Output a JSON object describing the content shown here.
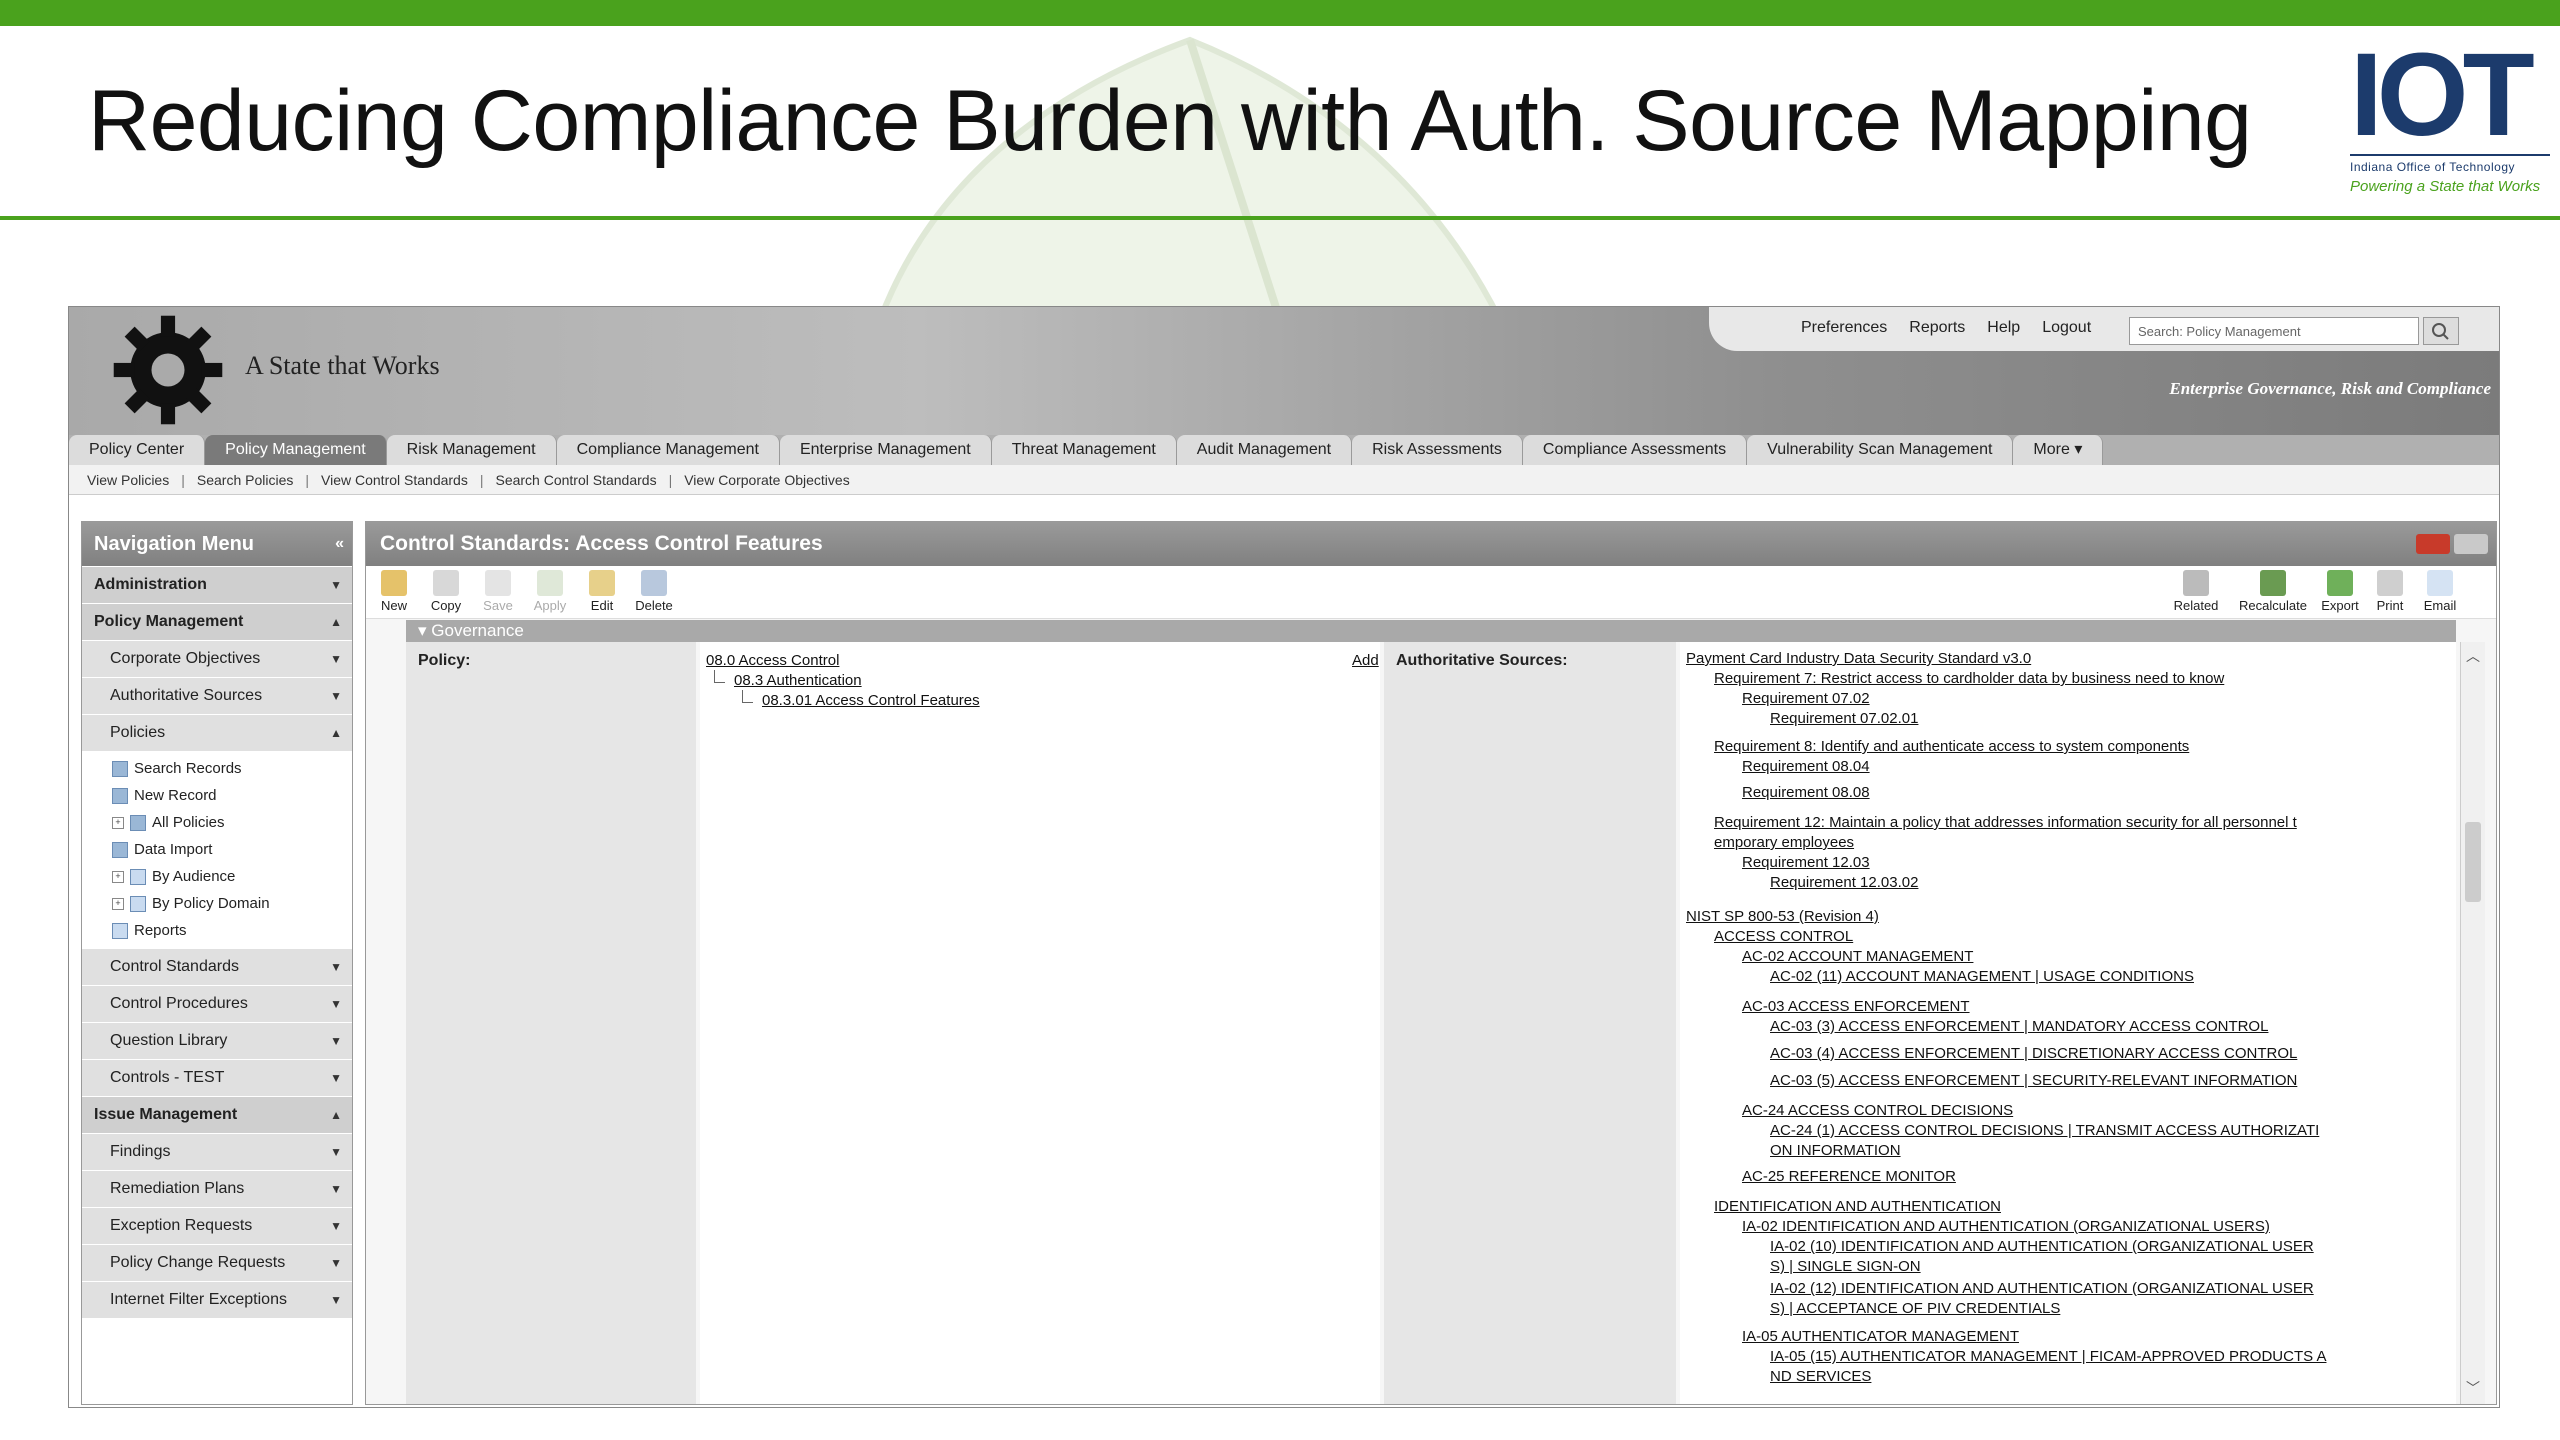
{
  "slide": {
    "title": "Reducing Compliance Burden with Auth. Source Mapping",
    "logo_main": "IOT",
    "logo_sub": "Indiana Office of Technology",
    "logo_tag": "Powering a State that Works"
  },
  "colors": {
    "brand_green": "#4aa21d",
    "brand_navy": "#1c3b6c",
    "close_red": "#c83a2a"
  },
  "banner": {
    "brand_text": "A State that Works",
    "links": [
      "Preferences",
      "Reports",
      "Help",
      "Logout"
    ],
    "search_placeholder": "Search: Policy Management",
    "tagline": "Enterprise Governance, Risk and Compliance"
  },
  "tabs": [
    "Policy Center",
    "Policy Management",
    "Risk Management",
    "Compliance Management",
    "Enterprise Management",
    "Threat Management",
    "Audit Management",
    "Risk Assessments",
    "Compliance Assessments",
    "Vulnerability Scan Management",
    "More ▾"
  ],
  "active_tab": "Policy Management",
  "subnav": [
    "View Policies",
    "Search Policies",
    "View Control Standards",
    "Search Control Standards",
    "View Corporate Objectives"
  ],
  "nav": {
    "title": "Navigation Menu",
    "administration": "Administration",
    "policy_management": "Policy Management",
    "pm_items": [
      "Corporate Objectives",
      "Authoritative Sources"
    ],
    "policies": "Policies",
    "tree": [
      "Search Records",
      "New Record",
      "All Policies",
      "Data Import",
      "By Audience",
      "By Policy Domain",
      "Reports"
    ],
    "pm_items2": [
      "Control Standards",
      "Control Procedures",
      "Question Library",
      "Controls - TEST"
    ],
    "issue_management": "Issue Management",
    "im_items": [
      "Findings",
      "Remediation Plans",
      "Exception Requests",
      "Policy Change Requests",
      "Internet Filter Exceptions"
    ]
  },
  "content": {
    "title": "Control Standards: Access Control Features",
    "toolbar_left": [
      "New",
      "Copy",
      "Save",
      "Apply",
      "Edit",
      "Delete"
    ],
    "toolbar_right": [
      "Related",
      "Recalculate",
      "Export",
      "Print",
      "Email"
    ],
    "section": "Governance",
    "policy_label": "Policy:",
    "policy_links": [
      "08.0 Access Control",
      "08.3 Authentication",
      "08.3.01 Access Control Features"
    ],
    "add_label": "Add",
    "auth_label": "Authoritative Sources:",
    "auth_links": [
      "Payment Card Industry Data Security Standard v3.0",
      "Requirement 7: Restrict access to cardholder data by business need to know",
      "Requirement 07.02",
      "Requirement 07.02.01",
      "Requirement 8: Identify and authenticate access to system components",
      "Requirement 08.04",
      "Requirement 08.08",
      "Requirement 12: Maintain a policy that addresses information security for all personnel t",
      "emporary employees",
      "Requirement 12.03",
      "Requirement 12.03.02",
      "NIST SP 800-53 (Revision 4)",
      "ACCESS CONTROL",
      "AC-02 ACCOUNT MANAGEMENT",
      "AC-02 (11) ACCOUNT MANAGEMENT | USAGE CONDITIONS",
      "AC-03 ACCESS ENFORCEMENT",
      "AC-03 (3) ACCESS ENFORCEMENT | MANDATORY ACCESS CONTROL",
      "AC-03 (4) ACCESS ENFORCEMENT | DISCRETIONARY ACCESS CONTROL",
      "AC-03 (5) ACCESS ENFORCEMENT | SECURITY-RELEVANT INFORMATION",
      "AC-24 ACCESS CONTROL DECISIONS",
      "AC-24 (1) ACCESS CONTROL DECISIONS | TRANSMIT ACCESS AUTHORIZATI",
      "ON INFORMATION",
      "AC-25 REFERENCE MONITOR",
      "IDENTIFICATION AND AUTHENTICATION",
      "IA-02 IDENTIFICATION AND AUTHENTICATION (ORGANIZATIONAL USERS)",
      "IA-02 (10) IDENTIFICATION AND AUTHENTICATION (ORGANIZATIONAL USER",
      "S) | SINGLE SIGN-ON",
      "IA-02 (12) IDENTIFICATION AND AUTHENTICATION (ORGANIZATIONAL USER",
      "S) | ACCEPTANCE OF PIV CREDENTIALS",
      "IA-05 AUTHENTICATOR MANAGEMENT",
      "IA-05 (15) AUTHENTICATOR MANAGEMENT | FICAM-APPROVED PRODUCTS A",
      "ND SERVICES"
    ]
  }
}
